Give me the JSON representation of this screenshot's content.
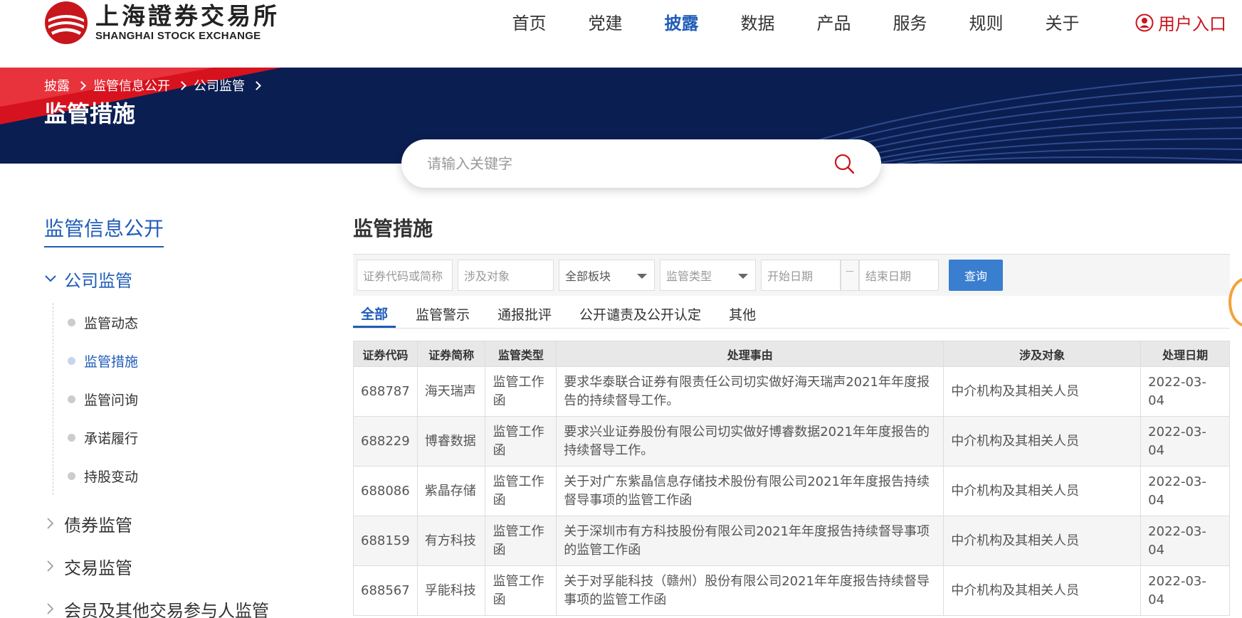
{
  "header": {
    "logo": {
      "cn": "上海證券交易所",
      "en": "SHANGHAI STOCK EXCHANGE"
    },
    "nav": [
      "首页",
      "党建",
      "披露",
      "数据",
      "产品",
      "服务",
      "规则",
      "关于"
    ],
    "nav_active_index": 2,
    "user_entry": "用户入口"
  },
  "banner": {
    "breadcrumb": [
      "披露",
      "监管信息公开",
      "公司监管"
    ],
    "title": "监管措施"
  },
  "search": {
    "placeholder": "请输入关键字"
  },
  "sidebar": {
    "title": "监管信息公开",
    "open_group": "公司监管",
    "sub_items": [
      "监管动态",
      "监管措施",
      "监管问询",
      "承诺履行",
      "持股变动"
    ],
    "active_sub_index": 1,
    "groups": [
      "债券监管",
      "交易监管",
      "会员及其他交易参与人监管"
    ]
  },
  "main": {
    "title": "监管措施",
    "filters": {
      "code_placeholder": "证券代码或简称",
      "target_placeholder": "涉及对象",
      "board": "全部板块",
      "reg_type": "监管类型",
      "start_date": "开始日期",
      "dash": "—",
      "end_date": "结束日期",
      "query": "查询"
    },
    "tabs": [
      "全部",
      "监管警示",
      "通报批评",
      "公开谴责及公开认定",
      "其他"
    ],
    "table": {
      "headers": [
        "证券代码",
        "证券简称",
        "监管类型",
        "处理事由",
        "涉及对象",
        "处理日期"
      ],
      "rows": [
        [
          "688787",
          "海天瑞声",
          "监管工作函",
          "要求华泰联合证券有限责任公司切实做好海天瑞声2021年年度报告的持续督导工作。",
          "中介机构及其相关人员",
          "2022-03-04"
        ],
        [
          "688229",
          "博睿数据",
          "监管工作函",
          "要求兴业证券股份有限公司切实做好博睿数据2021年年度报告的持续督导工作。",
          "中介机构及其相关人员",
          "2022-03-04"
        ],
        [
          "688086",
          "紫晶存储",
          "监管工作函",
          "关于对广东紫晶信息存储技术股份有限公司2021年年度报告持续督导事项的监管工作函",
          "中介机构及其相关人员",
          "2022-03-04"
        ],
        [
          "688159",
          "有方科技",
          "监管工作函",
          "关于深圳市有方科技股份有限公司2021年年度报告持续督导事项的监管工作函",
          "中介机构及其相关人员",
          "2022-03-04"
        ],
        [
          "688567",
          "孚能科技",
          "监管工作函",
          "关于对孚能科技（赣州）股份有限公司2021年年度报告持续督导事项的监管工作函",
          "中介机构及其相关人员",
          "2022-03-04"
        ]
      ]
    }
  },
  "colors": {
    "brand_red": "#c8161d",
    "accent_blue": "#1f5cb8",
    "banner_navy": "#0b1e52",
    "button_blue": "#3a7ed0"
  }
}
